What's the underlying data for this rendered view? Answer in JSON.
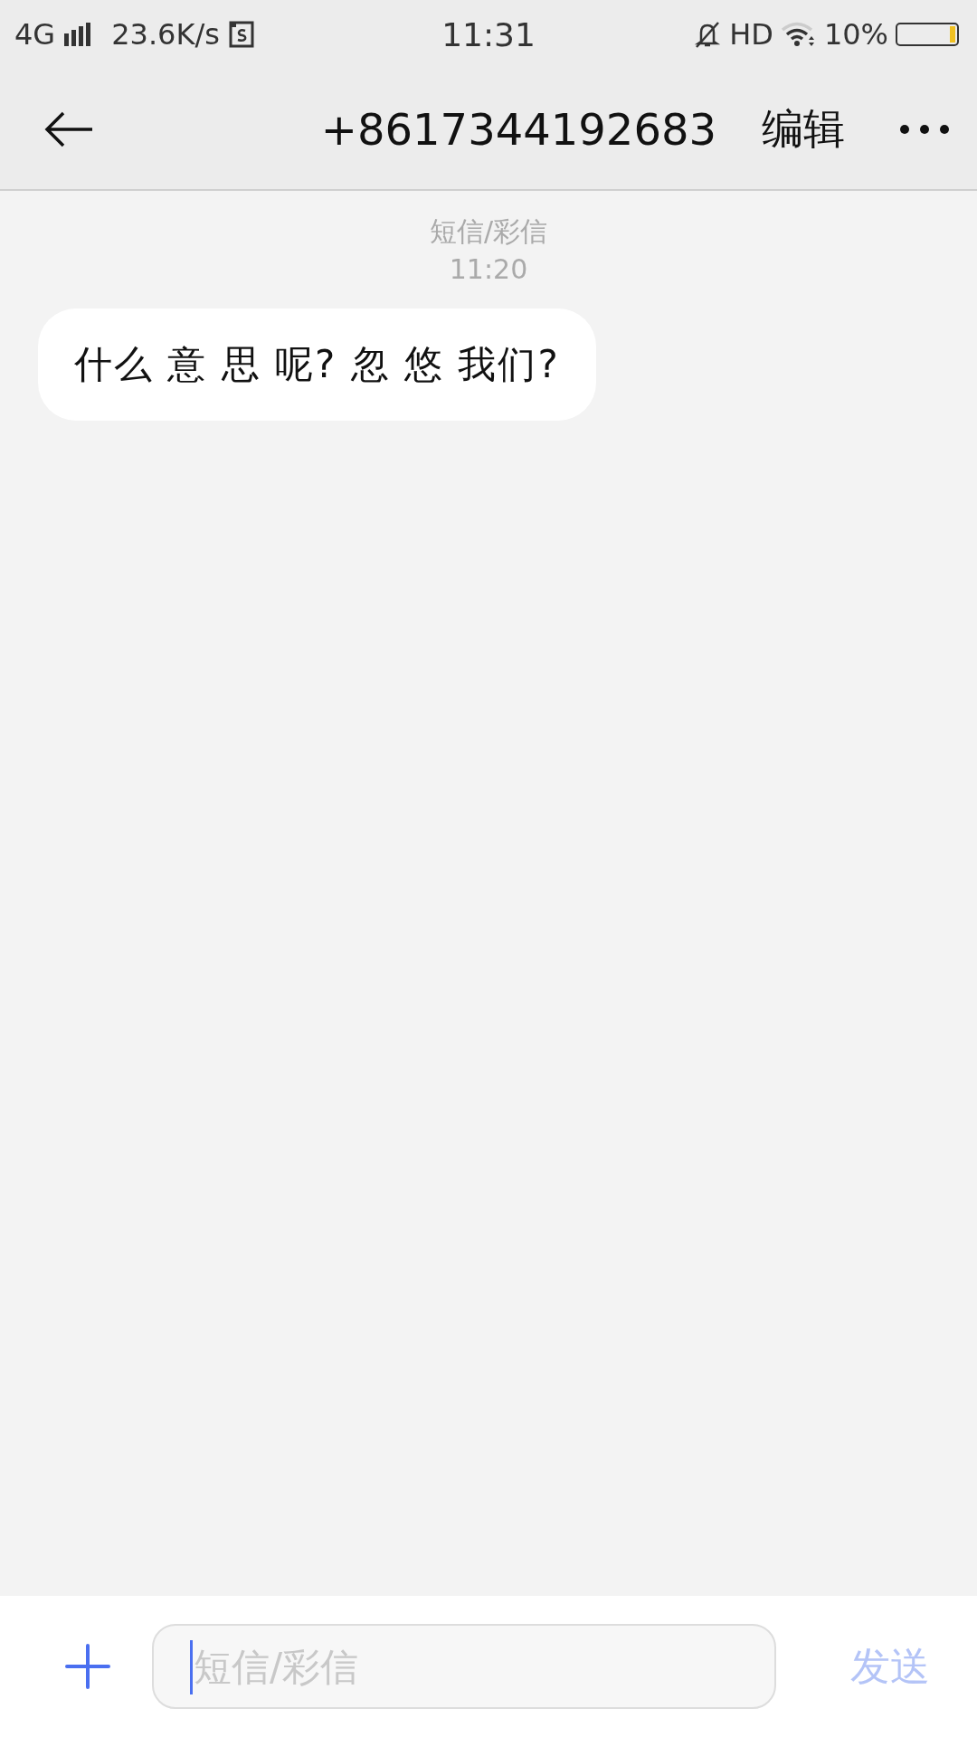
{
  "status_bar": {
    "network": "4G",
    "speed": "23.6K/s",
    "time": "11:31",
    "hd": "HD",
    "battery_text": "10%"
  },
  "header": {
    "title": "+8617344192683",
    "edit": "编辑"
  },
  "conversation": {
    "label": "短信/彩信",
    "time": "11:20",
    "messages": [
      {
        "text": "什么 意 思 呢? 忽 悠 我们?"
      }
    ]
  },
  "composer": {
    "placeholder": "短信/彩信",
    "send": "发送",
    "send_disabled": true
  }
}
